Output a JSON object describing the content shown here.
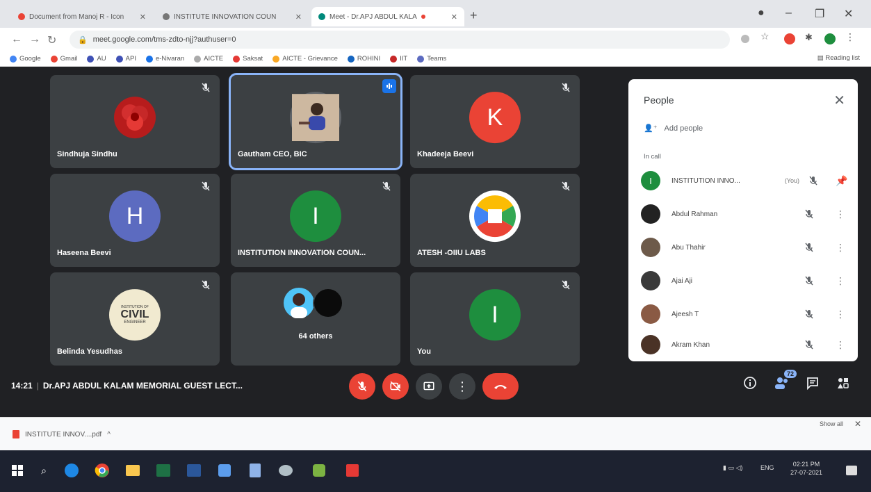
{
  "browser": {
    "tabs": [
      {
        "title": "Document from Manoj R - Icon"
      },
      {
        "title": "INSTITUTE INNOVATION COUN"
      },
      {
        "title": "Meet - Dr.APJ ABDUL KALA"
      }
    ],
    "url": "meet.google.com/tms-zdto-njj?authuser=0",
    "bookmarks": [
      "Google",
      "Gmail",
      "AU",
      "API",
      "e-Nivaran",
      "AICTE",
      "Saksat",
      "AICTE - Grievance",
      "ROHINI",
      "IIT",
      "Teams"
    ],
    "reading_list": "Reading list"
  },
  "tiles": [
    {
      "name": "Sindhuja Sindhu"
    },
    {
      "name": "Gautham CEO, BIC"
    },
    {
      "name": "Khadeeja Beevi",
      "initial": "K"
    },
    {
      "name": "Haseena Beevi",
      "initial": "H"
    },
    {
      "name": "INSTITUTION INNOVATION COUN...",
      "initial": "I"
    },
    {
      "name": "ATESH -OIIU LABS"
    },
    {
      "name": "Belinda Yesudhas",
      "badge_lines": [
        "INSTITUTION OF",
        "CIVIL",
        "ENGINEER"
      ]
    },
    {
      "name": "64 others"
    },
    {
      "name": "You",
      "initial": "I"
    }
  ],
  "people_panel": {
    "title": "People",
    "add_people": "Add people",
    "section": "In call",
    "participants": [
      {
        "name": "INSTITUTION INNO...",
        "you": "(You)",
        "initial": "I",
        "color": "#1e8e3e"
      },
      {
        "name": "Abdul Rahman",
        "color": "#222222"
      },
      {
        "name": "Abu Thahir",
        "color": "#6d5a4a"
      },
      {
        "name": "Ajai Aji",
        "color": "#3a3a3a"
      },
      {
        "name": "Ajeesh T",
        "color": "#8a5a44"
      },
      {
        "name": "Akram Khan",
        "color": "#4a3226"
      }
    ]
  },
  "meeting": {
    "time": "14:21",
    "title": "Dr.APJ ABDUL KALAM MEMORIAL GUEST LECT...",
    "participant_count": "72"
  },
  "download": {
    "file": "INSTITUTE INNOV....pdf",
    "show_all": "Show all"
  },
  "taskbar": {
    "lang": "ENG",
    "time": "02:21 PM",
    "date": "27-07-2021"
  },
  "colors": {
    "meet_bg": "#202124",
    "tile_bg": "#3c4043",
    "red": "#ea4335",
    "green_avatar": "#1e8e3e",
    "red_avatar": "#ea4335",
    "purple_avatar": "#5c6bc0",
    "active_outline": "#8ab4f8"
  }
}
